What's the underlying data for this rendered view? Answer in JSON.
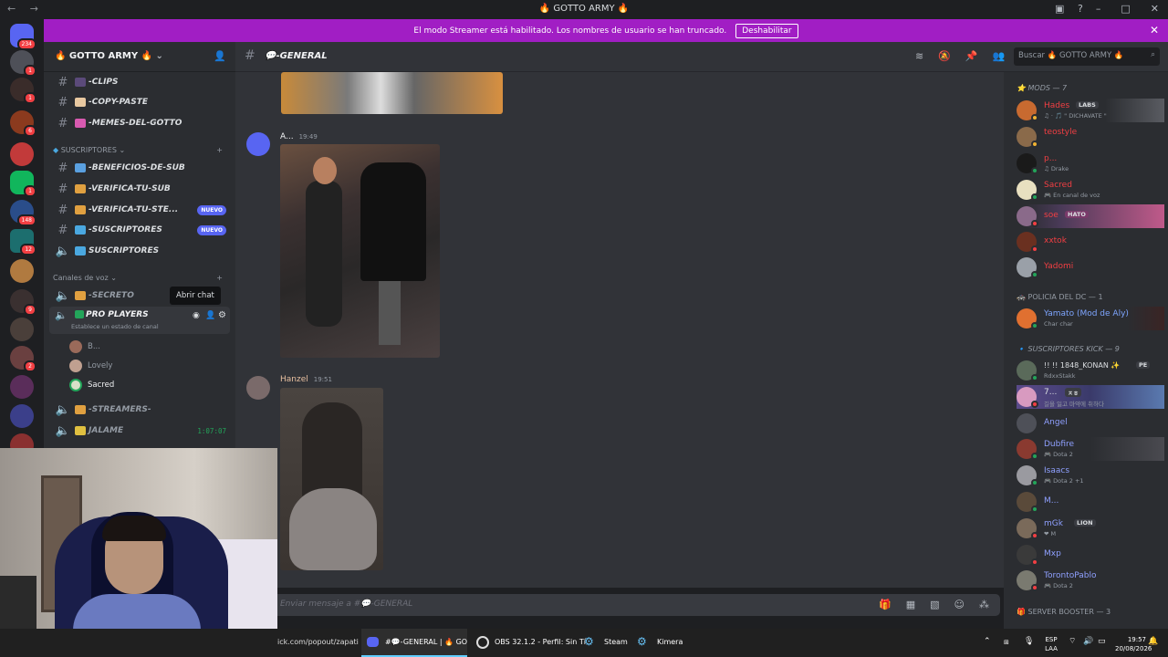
{
  "window": {
    "title": "🔥 GOTTO ARMY 🔥",
    "nav": "← →"
  },
  "streamer_banner": {
    "text": "El modo Streamer está habilitado. Los nombres de usuario se han truncado.",
    "button": "Deshabilitar"
  },
  "guilds": {
    "badges": [
      "234",
      "1",
      "1",
      "6",
      "1",
      "148",
      "12",
      "9",
      "2"
    ]
  },
  "server": {
    "name": "🔥 GOTTO ARMY 🔥"
  },
  "channels": {
    "top": [
      {
        "name": "-CLIPS"
      },
      {
        "name": "-COPY-PASTE"
      },
      {
        "name": "-MEMES-DEL-GOTTO"
      }
    ],
    "cat_subs": "SUSCRIPTORES",
    "subs": [
      {
        "name": "-BENEFICIOS-DE-SUB"
      },
      {
        "name": "-VERIFICA-TU-SUB"
      },
      {
        "name": "-VERIFICA-TU-STE...",
        "badge": "NUEVO"
      },
      {
        "name": "-SUSCRIPTORES",
        "badge": "NUEVO"
      },
      {
        "name": "SUSCRIPTORES"
      }
    ],
    "cat_voice": "Canales de voz",
    "voice": [
      {
        "name": "-SECRETO"
      },
      {
        "name": "PRO PLAYERS",
        "status": "Establece un estado de canal"
      },
      {
        "name": "-STREAMERS-"
      },
      {
        "name": "JALAME",
        "time": "1:07:07"
      }
    ],
    "voice_users": [
      "B...",
      "Lovely",
      "Sacred"
    ],
    "tooltip": "Abrir chat"
  },
  "chat": {
    "channel": "-GENERAL",
    "messages": [
      {
        "author": "A...",
        "time": "19:49"
      },
      {
        "author": "Hanzel",
        "time": "19:51"
      }
    ],
    "placeholder": "Enviar mensaje a #💬-GENERAL",
    "search": "Buscar 🔥 GOTTO ARMY 🔥"
  },
  "members": {
    "cat_mods": "MODS — 7",
    "mods": [
      {
        "name": "Hades",
        "tag": "LABS",
        "sub": "♫ · 🎵 \" DICHAVATE \"",
        "color": "#f23f43"
      },
      {
        "name": "teostyle",
        "sub": "",
        "color": "#f23f43"
      },
      {
        "name": "p...",
        "sub": "♫ Drake",
        "color": "#f23f43"
      },
      {
        "name": "Sacred",
        "sub": "🎮 En canal de voz",
        "color": "#f23f43"
      },
      {
        "name": "soe",
        "tag": "HATO",
        "sub": "",
        "color": "#f23f43"
      },
      {
        "name": "xxtok",
        "sub": "",
        "color": "#f23f43"
      },
      {
        "name": "Yadomi",
        "sub": "",
        "color": "#f23f43"
      }
    ],
    "cat_police": "POLICIA DEL DC — 1",
    "police": [
      {
        "name": "Yamato (Mod de Aly)",
        "sub": "Char char",
        "color": "#7ea5ff"
      }
    ],
    "cat_kick": "SUSCRIPTORES KICK — 9",
    "kick": [
      {
        "name": "!! !! 1848_KONAN ✨",
        "tag": "PE",
        "sub": "RdxxStakk",
        "color": "#8fa0ff"
      },
      {
        "name": "7...",
        "tag": "ㅈㅎ",
        "sub": "길을 잃고 마약에 취하다",
        "color": "#8fa0ff"
      },
      {
        "name": "Angel",
        "sub": "",
        "color": "#8fa0ff"
      },
      {
        "name": "Dubfire",
        "sub": "🎮 Dota 2",
        "color": "#8fa0ff"
      },
      {
        "name": "Isaacs",
        "sub": "🎮 Dota 2 +1",
        "color": "#8fa0ff"
      },
      {
        "name": "M...",
        "sub": "",
        "color": "#8fa0ff"
      },
      {
        "name": "mGk",
        "tag": "LION",
        "sub": "❤ M",
        "color": "#8fa0ff"
      },
      {
        "name": "Mxp",
        "sub": "",
        "color": "#8fa0ff"
      },
      {
        "name": "TorontoPablo",
        "sub": "🎮 Dota 2",
        "color": "#8fa0ff"
      }
    ],
    "cat_booster": "SERVER BOOSTER — 3"
  },
  "taskbar": {
    "url": "ick.com/popout/zapati",
    "discord": "#💬-GENERAL | 🔥 GO",
    "obs": "OBS 32.1.2 - Perfil: Sin Tí",
    "steam": "Steam",
    "kimera": "Kimera",
    "lang1": "ESP",
    "lang2": "LAA",
    "time": "19:57",
    "date": "20/08/2026"
  }
}
